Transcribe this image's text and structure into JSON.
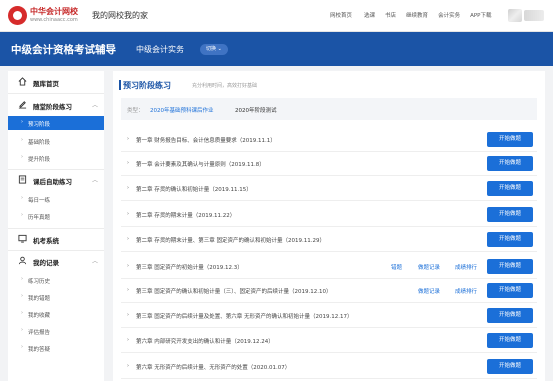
{
  "header": {
    "logo_cn": "中华会计网校",
    "logo_en": "www.chinaacc.com",
    "site_title": "我的网校我的家",
    "nav": [
      "网校首页",
      "选课",
      "书店",
      "继续教育",
      "会计实务",
      "APP下载"
    ]
  },
  "banner": {
    "title": "中级会计资格考试辅导",
    "subject": "中级会计实务",
    "switch_label": "切换"
  },
  "sidebar": {
    "sections": [
      {
        "label": "题库首页",
        "icon": "home-icon",
        "items": []
      },
      {
        "label": "随堂阶段练习",
        "icon": "edit-icon",
        "items": [
          "预习阶段",
          "基础阶段",
          "提升阶段"
        ],
        "active": "预习阶段"
      },
      {
        "label": "课后自助练习",
        "icon": "book-icon",
        "items": [
          "每日一练",
          "历年真题"
        ]
      },
      {
        "label": "机考系统",
        "icon": "exam-icon",
        "items": []
      },
      {
        "label": "我的记录",
        "icon": "user-icon",
        "items": [
          "练习历史",
          "我的错题",
          "我的收藏",
          "评估报告",
          "我的答疑"
        ]
      }
    ]
  },
  "main": {
    "title": "预习阶段练习",
    "subtitle": "充分利用时间，高效打好基础",
    "filter": {
      "label": "类型：",
      "options": [
        "2020年基础预科课后作业",
        "2020年阶段测试"
      ],
      "selected": "2020年基础预科课后作业"
    },
    "rows": [
      {
        "title": "第一章 财务报告目标、会计信息质量要求（2019.11.1）",
        "links": [],
        "button": "开始做题"
      },
      {
        "title": "第一章 会计要素及其确认与计量原则（2019.11.8）",
        "links": [],
        "button": "开始做题"
      },
      {
        "title": "第二章 存货的确认和初始计量（2019.11.15）",
        "links": [],
        "button": "开始做题"
      },
      {
        "title": "第二章 存货的期末计量（2019.11.22）",
        "links": [],
        "button": "开始做题"
      },
      {
        "title": "第二章 存货的期末计量、第三章 固定资产的确认和初始计量（2019.11.29）",
        "links": [],
        "button": "开始做题"
      },
      {
        "title": "第三章 固定资产的初始计量（2019.12.3）",
        "links": [
          "错题",
          "做题记录",
          "成绩排行"
        ],
        "button": "开始做题"
      },
      {
        "title": "第三章 固定资产的确认和初始计量（三）、固定资产的后续计量（2019.12.10）",
        "links": [
          "做题记录",
          "成绩排行"
        ],
        "button": "开始做题"
      },
      {
        "title": "第三章 固定资产的后续计量及处置、第六章 无形资产的确认和初始计量（2019.12.17）",
        "links": [],
        "button": "开始做题"
      },
      {
        "title": "第六章 内部研究开发支出的确认和计量（2019.12.24）",
        "links": [],
        "button": "开始做题"
      },
      {
        "title": "第六章 无形资产的后续计量、无形资产的处置（2020.01.07）",
        "links": [],
        "button": "开始做题"
      }
    ]
  },
  "colors": {
    "brand_blue": "#1b54a6",
    "button_blue": "#1b6fd8",
    "logo_red": "#d62b2b"
  }
}
